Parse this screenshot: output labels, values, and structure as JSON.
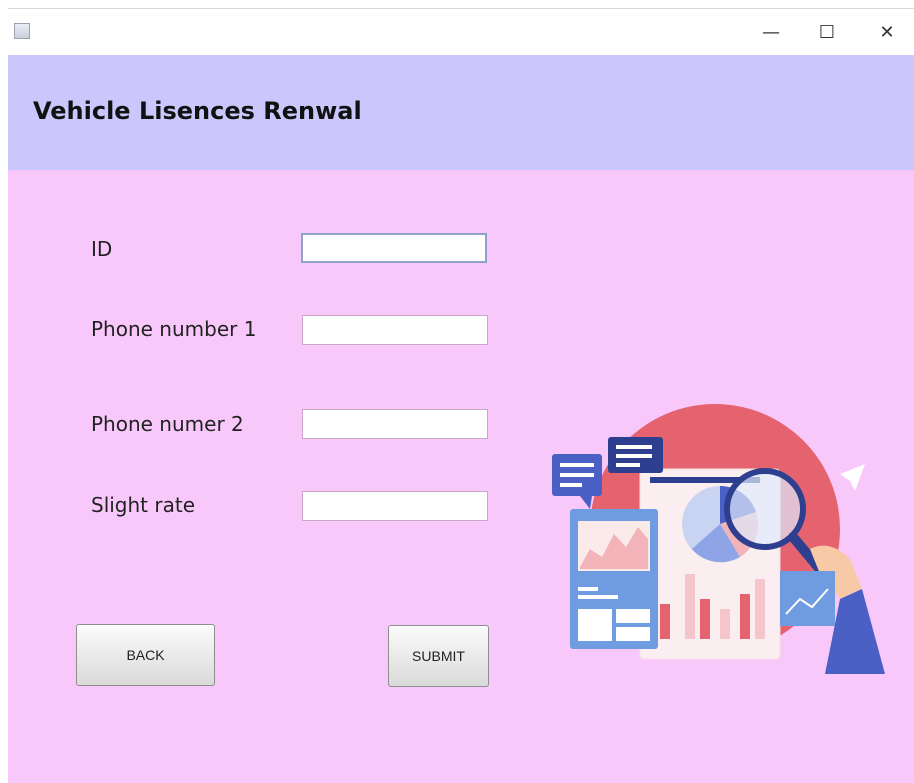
{
  "window": {
    "minimize_glyph": "—",
    "maximize_glyph": "☐",
    "close_glyph": "✕"
  },
  "header": {
    "title": "Vehicle Lisences Renwal"
  },
  "form": {
    "fields": [
      {
        "label": "ID",
        "value": "",
        "placeholder": ""
      },
      {
        "label": "Phone number 1",
        "value": "",
        "placeholder": ""
      },
      {
        "label": "Phone numer 2",
        "value": "",
        "placeholder": ""
      },
      {
        "label": "Slight rate",
        "value": "",
        "placeholder": ""
      }
    ]
  },
  "buttons": {
    "back": "BACK",
    "submit": "SUBMIT"
  },
  "illustration": {
    "icon": "data-analysis-illustration"
  },
  "colors": {
    "background": "#f9c8fb",
    "header": "#cbc7fd",
    "accent_red": "#e5636f",
    "accent_blue": "#4a60c4"
  }
}
